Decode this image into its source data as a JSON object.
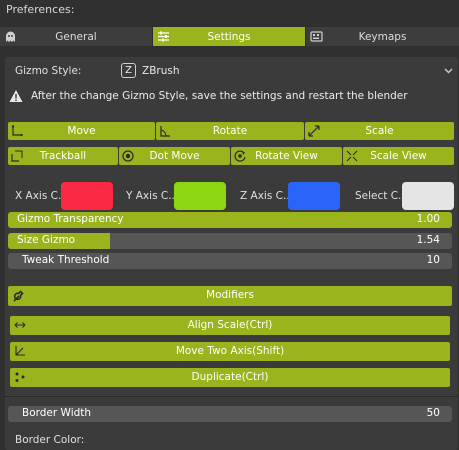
{
  "window": {
    "title": "Preferences:"
  },
  "tabs": [
    {
      "label": "General",
      "icon": "ghost-icon"
    },
    {
      "label": "Settings",
      "icon": "sliders-icon",
      "active": true
    },
    {
      "label": "Keymaps",
      "icon": "keyboard-icon"
    }
  ],
  "gizmo_style": {
    "label": "Gizmo Style:",
    "value": "ZBrush",
    "badge": "Z"
  },
  "warning": "After the change Gizmo Style, save the settings and restart the blender",
  "transform_buttons": [
    {
      "label": "Move",
      "icon": "move-icon"
    },
    {
      "label": "Rotate",
      "icon": "rotate-icon"
    },
    {
      "label": "Scale",
      "icon": "scale-icon"
    }
  ],
  "view_buttons": [
    {
      "label": "Trackball",
      "icon": "trackball-icon"
    },
    {
      "label": "Dot Move",
      "icon": "dot-move-icon"
    },
    {
      "label": "Rotate View",
      "icon": "rotate-view-icon"
    },
    {
      "label": "Scale View",
      "icon": "scale-view-icon"
    }
  ],
  "axis_colors": [
    {
      "label": "X Axis C..",
      "color": "#fa2a45"
    },
    {
      "label": "Y Axis C..",
      "color": "#8dd712"
    },
    {
      "label": "Z Axis C..",
      "color": "#2b64f8"
    },
    {
      "label": "Select C..",
      "color": "#e5e5e5"
    }
  ],
  "sliders": [
    {
      "label": "Gizmo Transparency",
      "value": "1.00",
      "fraction": 1.0
    },
    {
      "label": "Size Gizmo",
      "value": "1.54",
      "fraction": 0.23
    },
    {
      "label": "Tweak Threshold",
      "value": "10",
      "fraction": 0.0
    }
  ],
  "modifiers": {
    "label": "Modifiers",
    "icon": "wrench-icon"
  },
  "modifier_buttons": [
    {
      "label": "Align Scale(Ctrl)",
      "icon": "align-scale-icon"
    },
    {
      "label": "Move Two Axis(Shift)",
      "icon": "move-two-axis-icon"
    },
    {
      "label": "Duplicate(Ctrl)",
      "icon": "duplicate-icon"
    }
  ],
  "border_width": {
    "label": "Border Width",
    "value": "50"
  },
  "border_color": {
    "label": "Border Color:"
  },
  "colors": {
    "accent": "#99b41c",
    "panel": "#3b3b3b",
    "background": "#303030",
    "field": "#565656"
  }
}
